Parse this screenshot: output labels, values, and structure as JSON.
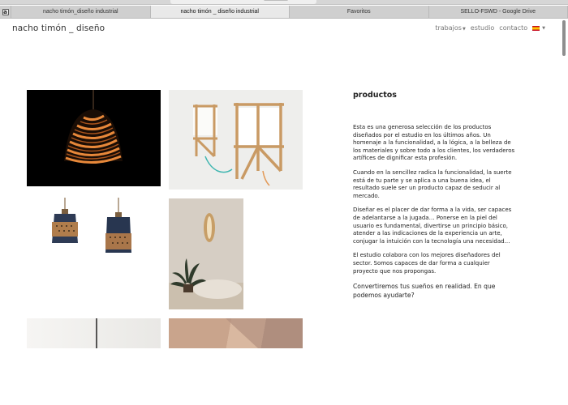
{
  "browser": {
    "tabs": [
      {
        "label": "nacho timón_diseño industrial",
        "active": false
      },
      {
        "label": "nacho timón _ diseño industrial",
        "active": true
      },
      {
        "label": "Favoritos",
        "active": false
      },
      {
        "label": "SELLO-FSWD - Google Drive",
        "active": false
      }
    ],
    "pinned_icon": "amazon-icon",
    "pinned_letter": "a"
  },
  "site": {
    "logo": "nacho timón _ diseño",
    "nav": {
      "trabajos": "trabajos",
      "estudio": "estudio",
      "contacto": "contacto",
      "language_icon": "spain-flag-icon"
    }
  },
  "gallery": [
    {
      "name": "pendant-lamp-spiral",
      "icon": "lamp-image"
    },
    {
      "name": "table-lamps-wood",
      "icon": "lamp-image"
    },
    {
      "name": "pendant-lamps-blue",
      "icon": "lamp-image"
    },
    {
      "name": "wall-lamp-brass",
      "icon": "lamp-image"
    },
    {
      "name": "product-photo-5",
      "icon": "image"
    },
    {
      "name": "product-photo-6",
      "icon": "image"
    }
  ],
  "content": {
    "heading": "productos",
    "p1": "Esta es una generosa selección de los productos diseñados por el estudio en los últimos años. Un homenaje a la funcionalidad, a la lógica, a la belleza de los materiales y sobre todo a los clientes, los verdaderos artífices de dignificar esta profesión.",
    "p2": "Cuando en la sencillez radica la funcionalidad, la suerte está de tu parte y se aplica a una buena idea, el resultado suele ser un producto capaz de seducir al mercado.",
    "p3": "Diseñar es el placer de dar forma a la vida, ser capaces de adelantarse a la jugada… Ponerse en la piel del usuario es fundamental, divertirse un principio básico, atender a las indicaciones de la experiencia un arte, conjugar la intuición con la tecnología una necesidad…",
    "p4": "El estudio colabora con los mejores diseñadores del sector. Somos capaces de dar forma a cualquier proyecto que nos propongas.",
    "p5": "Convertiremos tus sueños en realidad. En que podemos ayudarte?"
  },
  "colors": {
    "text": "#222222",
    "nav": "#777777",
    "tab_bar": "#cfcfcf"
  }
}
